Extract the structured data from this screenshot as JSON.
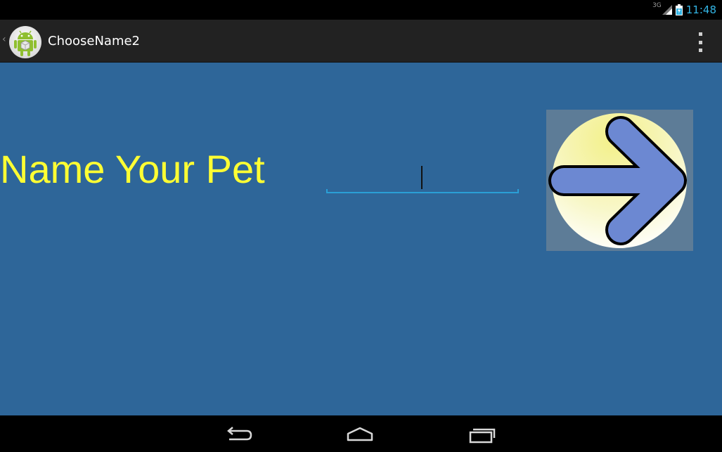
{
  "status_bar": {
    "network": "3G",
    "time": "11:48",
    "clock_color": "#33b5e5"
  },
  "action_bar": {
    "title": "ChooseName2",
    "icons": [
      "up-caret-icon",
      "android-app-icon",
      "overflow-menu-icon"
    ]
  },
  "main": {
    "heading": "Name Your Pet",
    "heading_color": "#ffff33",
    "background_color": "#2e6699",
    "name_input": {
      "value": "",
      "placeholder": ""
    },
    "next_button_icon": "right-arrow-icon"
  },
  "nav_bar": {
    "buttons": [
      "back-icon",
      "home-icon",
      "recent-apps-icon"
    ]
  }
}
